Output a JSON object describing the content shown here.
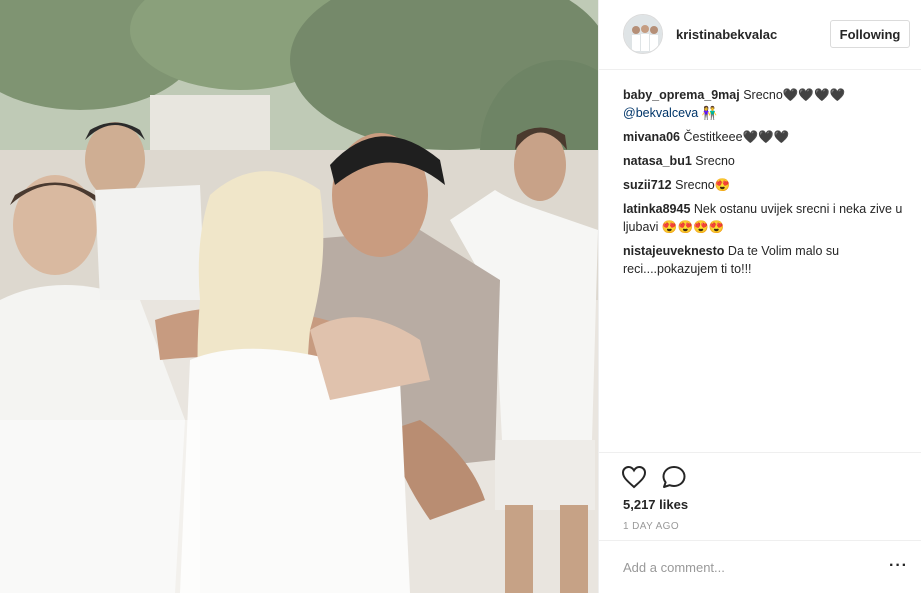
{
  "post": {
    "username": "kristinabekvalac",
    "follow_label": "Following",
    "photo_alt": "wedding photo"
  },
  "comments": [
    {
      "author": "baby_oprema_9maj",
      "text": "Srecno🖤🖤🖤🖤",
      "mention": "@bekvalceva",
      "emoji": "👫"
    },
    {
      "author": "mivana06",
      "text": "Čestitkeee🖤🖤🖤"
    },
    {
      "author": "natasa_bu1",
      "text": "Srecno"
    },
    {
      "author": "suzii712",
      "text": "Srecno😍"
    },
    {
      "author": "latinka8945",
      "text": "Nek ostanu uvijek srecni i neka zive u ljubavi 😍😍😍😍"
    },
    {
      "author": "nistajeuveknesto",
      "text": "Da te Volim malo su reci....pokazujem ti to!!!"
    }
  ],
  "actions": {
    "like_icon": "heart-icon",
    "comment_icon": "comment-icon",
    "likes": "5,217 likes",
    "time": "1 DAY AGO"
  },
  "add_comment": {
    "placeholder": "Add a comment...",
    "more": "···"
  }
}
